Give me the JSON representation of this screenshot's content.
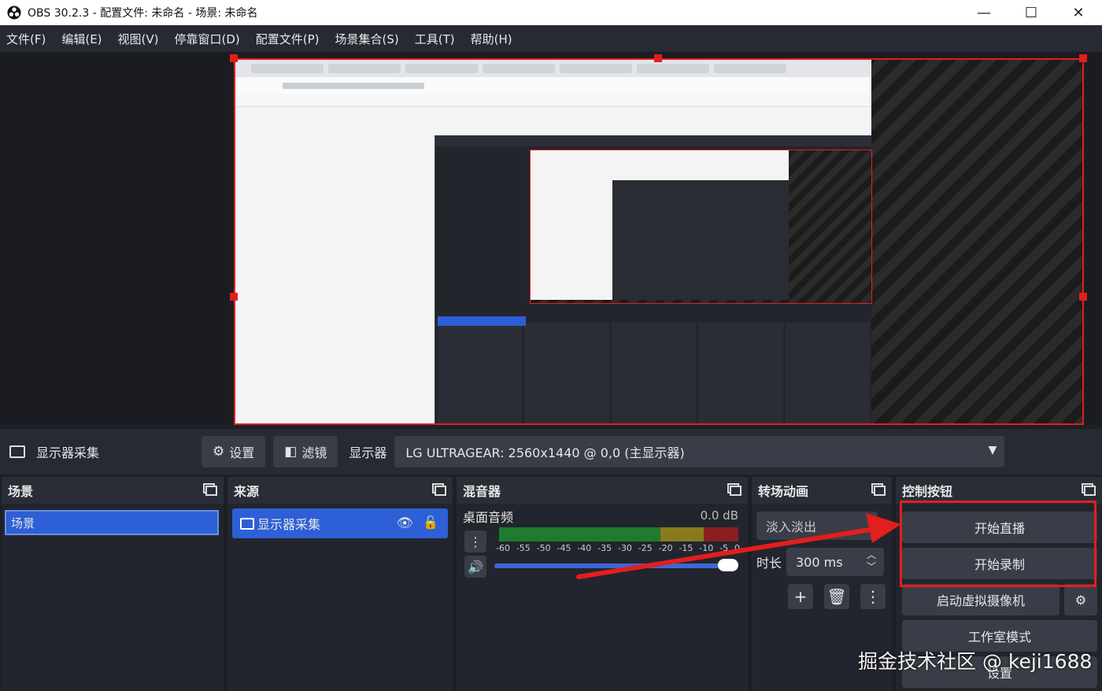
{
  "window": {
    "title": "OBS 30.2.3 - 配置文件: 未命名 - 场景: 未命名",
    "minimize": "—",
    "maximize": "☐",
    "close": "✕"
  },
  "menu": [
    "文件(F)",
    "编辑(E)",
    "视图(V)",
    "停靠窗口(D)",
    "配置文件(P)",
    "场景集合(S)",
    "工具(T)",
    "帮助(H)"
  ],
  "properties_bar": {
    "source_name": "显示器采集",
    "settings_label": "设置",
    "filters_label": "滤镜",
    "display_label": "显示器",
    "display_value": "LG ULTRAGEAR: 2560x1440 @ 0,0 (主显示器)"
  },
  "scenes": {
    "title": "场景",
    "items": [
      "场景"
    ]
  },
  "sources": {
    "title": "来源",
    "items": [
      "显示器采集"
    ]
  },
  "mixer": {
    "title": "混音器",
    "track_name": "桌面音频",
    "db": "0.0 dB",
    "ticks": [
      "-60",
      "-55",
      "-50",
      "-45",
      "-40",
      "-35",
      "-30",
      "-25",
      "-20",
      "-15",
      "-10",
      "-5",
      "0"
    ],
    "volume": 1.0
  },
  "transitions": {
    "title": "转场动画",
    "selected": "淡入淡出",
    "duration_label": "时长",
    "duration_value": "300 ms"
  },
  "controls": {
    "title": "控制按钮",
    "start_stream": "开始直播",
    "start_record": "开始录制",
    "virtual_cam": "启动虚拟摄像机",
    "studio_mode": "工作室模式",
    "settings": "设置"
  },
  "watermark": "掘金技术社区 @ keji1688",
  "colors": {
    "accent": "#2d5fd6",
    "highlight": "#e21e1e"
  }
}
